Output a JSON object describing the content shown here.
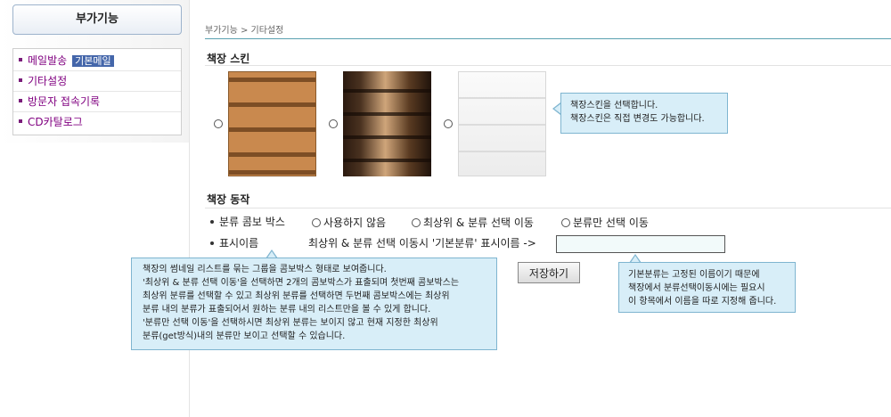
{
  "sidebar": {
    "title": "부가기능",
    "items": [
      {
        "label": "메일발송",
        "badge": "기본메일"
      },
      {
        "label": "기타설정"
      },
      {
        "label": "방문자 접속기록"
      },
      {
        "label": "CD카탈로그"
      }
    ]
  },
  "breadcrumb": "부가기능 > 기타설정",
  "skin_section": {
    "title": "책장 스킨",
    "tooltip": [
      "책장스킨을 선택합니다.",
      "책장스킨은 직접 변경도 가능합니다."
    ]
  },
  "action_section": {
    "title": "책장 동작",
    "combo_label": "분류 콤보 박스",
    "options": [
      "사용하지 않음",
      "최상위 & 분류 선택 이동",
      "분류만 선택 이동"
    ],
    "display_label": "표시이름",
    "display_prompt": "최상위 & 분류 선택 이동시 '기본분류' 표시이름 ->",
    "display_value": "",
    "save_label": "저장하기",
    "combo_tooltip": [
      "책장의 썸네일 리스트를 묶는 그룹을 콤보박스 형태로 보여줍니다.",
      "'최상위 & 분류 선택 이동'을 선택하면 2개의 콤보박스가 표출되며 첫번째 콤보박스는",
      "최상위 분류를 선택할 수 있고 최상위 분류를 선택하면 두번째 콤보박스에는 최상위",
      "분류 내의 분류가 표출되어서 원하는 분류 내의 리스트만을 볼 수 있게 합니다.",
      "'분류만 선택 이동'을 선택하시면 최상위 분류는 보이지 않고 현재 지정한 최상위",
      "분류(get방식)내의 분류만 보이고 선택할 수 있습니다."
    ],
    "display_tooltip": [
      "기본분류는 고정된 이름이기 때문에",
      "책장에서 분류선택이동시에는 필요시",
      "이 항목에서 이름을 따로 지정해 줍니다."
    ]
  }
}
